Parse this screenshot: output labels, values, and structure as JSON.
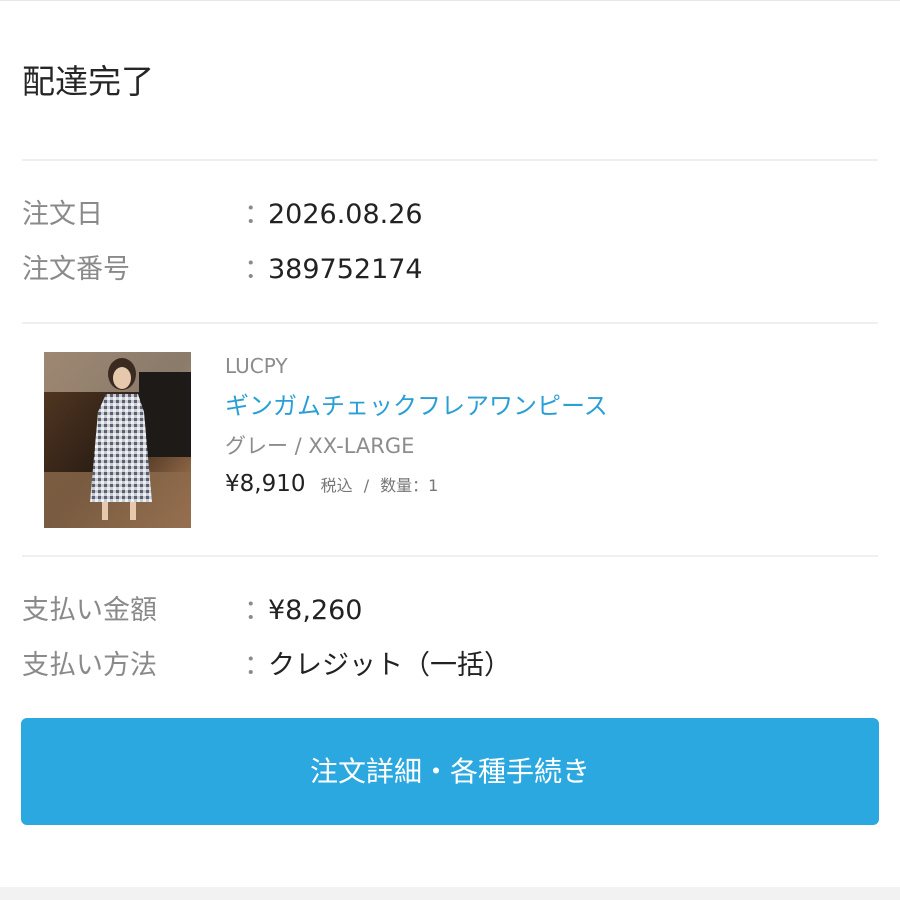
{
  "order": {
    "status": "配達完了",
    "date_label": "注文日",
    "date_value": "2026.08.26",
    "number_label": "注文番号",
    "number_value": "389752174",
    "colon": "："
  },
  "item": {
    "brand": "LUCPY",
    "name": "ギンガムチェックフレアワンピース",
    "variant": "グレー / XX-LARGE",
    "price": "¥8,910",
    "tax": "税込",
    "sep": "/",
    "qty": "数量：1",
    "image": "product-photo-checked-dress"
  },
  "payment": {
    "amount_label": "支払い金額",
    "amount_value": "¥8,260",
    "method_label": "支払い方法",
    "method_value": "クレジット（一括）"
  },
  "actions": {
    "details_label": "注文詳細・各種手続き"
  },
  "colors": {
    "accent": "#2aa8df",
    "link": "#2a9fd6",
    "label": "#8a8a8a"
  }
}
